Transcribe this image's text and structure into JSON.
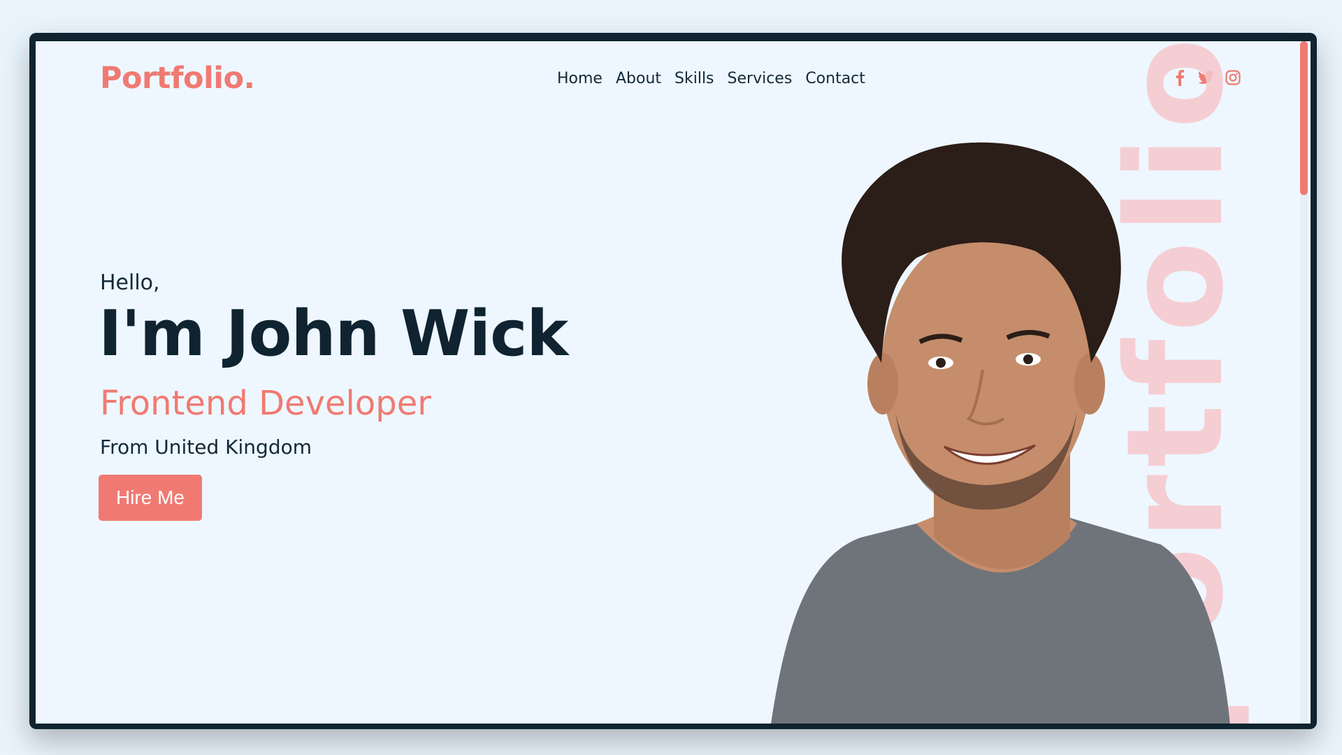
{
  "logo": "Portfolio.",
  "nav": [
    "Home",
    "About",
    "Skills",
    "Services",
    "Contact"
  ],
  "social": [
    {
      "name": "facebook-icon",
      "glyph": "f"
    },
    {
      "name": "twitter-icon",
      "glyph": ""
    },
    {
      "name": "instagram-icon",
      "glyph": ""
    }
  ],
  "hero": {
    "greeting": "Hello,",
    "name": "I'm John Wick",
    "role": "Frontend Developer",
    "from": "From United Kingdom",
    "cta": "Hire Me",
    "background_word": "portfolio"
  },
  "colors": {
    "accent": "#f07a72",
    "dark": "#0f2330",
    "background": "#eef7ff"
  }
}
